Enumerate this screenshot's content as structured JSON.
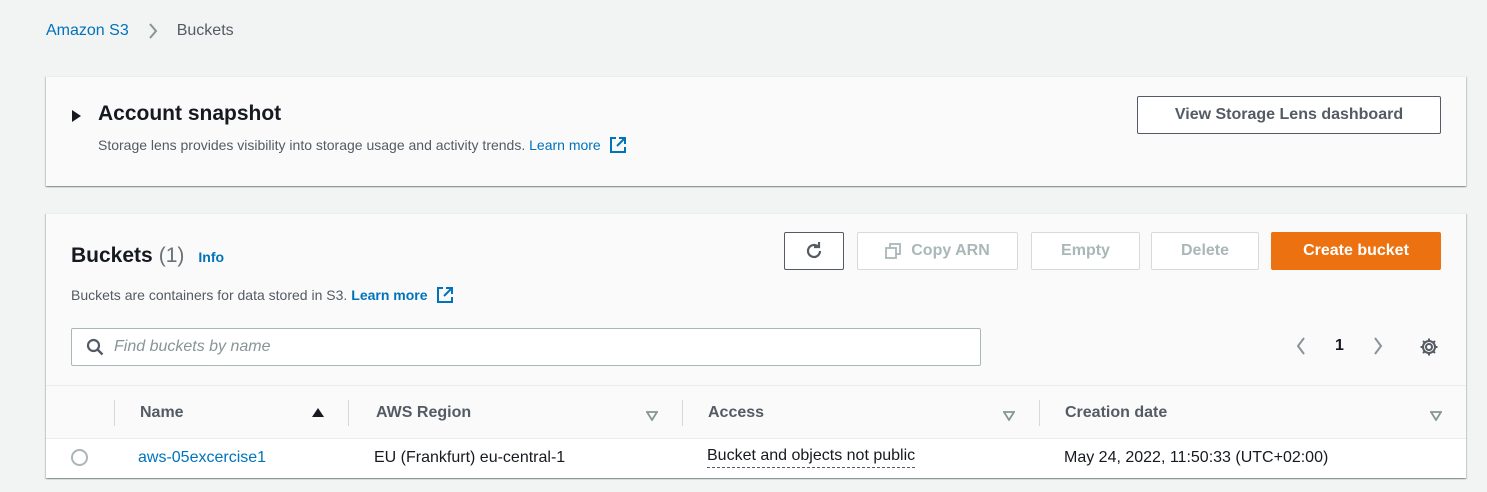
{
  "breadcrumb": {
    "root": "Amazon S3",
    "current": "Buckets"
  },
  "snapshot": {
    "title": "Account snapshot",
    "description": "Storage lens provides visibility into storage usage and activity trends.",
    "learn_more": "Learn more",
    "dashboard_button": "View Storage Lens dashboard"
  },
  "buckets": {
    "title": "Buckets",
    "count": "(1)",
    "info": "Info",
    "description": "Buckets are containers for data stored in S3.",
    "learn_more": "Learn more",
    "actions": {
      "copy_arn": "Copy ARN",
      "empty": "Empty",
      "delete": "Delete",
      "create": "Create bucket"
    },
    "search": {
      "placeholder": "Find buckets by name",
      "value": ""
    },
    "pagination": {
      "page": "1"
    },
    "columns": [
      "Name",
      "AWS Region",
      "Access",
      "Creation date"
    ],
    "rows": [
      {
        "name": "aws-05excercise1",
        "region": "EU (Frankfurt) eu-central-1",
        "access": "Bucket and objects not public",
        "created": "May 24, 2022, 11:50:33 (UTC+02:00)"
      }
    ]
  },
  "colors": {
    "link": "#0073bb",
    "primary_button": "#ec7211",
    "disabled": "#aab7b8",
    "text": "#16191f",
    "background": "#f2f3f3"
  }
}
